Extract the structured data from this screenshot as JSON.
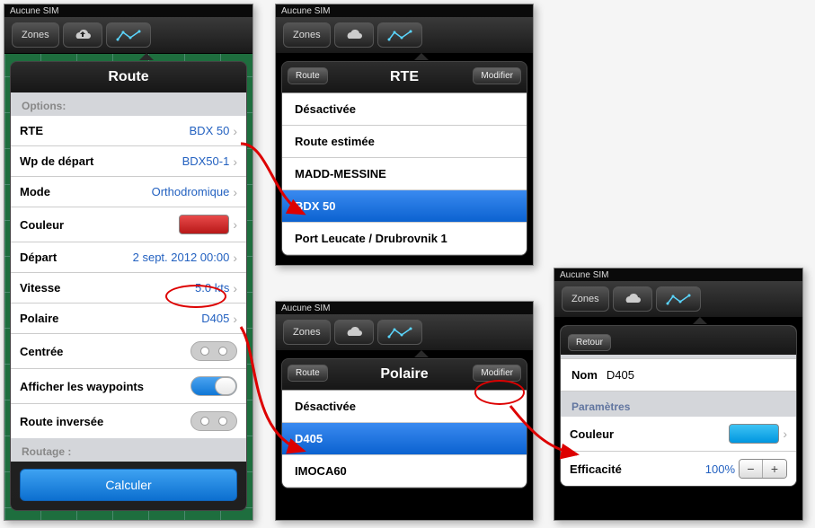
{
  "status": {
    "no_sim": "Aucune SIM"
  },
  "toolbar": {
    "zones_label": "Zones"
  },
  "panel_route": {
    "title": "Route",
    "section_options": "Options:",
    "rows": {
      "rte_label": "RTE",
      "rte_value": "BDX 50",
      "wp_label": "Wp de départ",
      "wp_value": "BDX50-1",
      "mode_label": "Mode",
      "mode_value": "Orthodromique",
      "color_label": "Couleur",
      "depart_label": "Départ",
      "depart_value": "2 sept. 2012 00:00",
      "speed_label": "Vitesse",
      "speed_value": "5.0 kts",
      "polar_label": "Polaire",
      "polar_value": "D405",
      "centered_label": "Centrée",
      "show_wp_label": "Afficher les waypoints",
      "reverse_label": "Route inversée"
    },
    "section_routing": "Routage :",
    "calc_button": "Calculer"
  },
  "panel_rte": {
    "title": "RTE",
    "back_label": "Route",
    "modify_label": "Modifier",
    "items": [
      "Désactivée",
      "Route estimée",
      "MADD-MESSINE",
      "BDX 50",
      "Port Leucate / Drubrovnik 1"
    ]
  },
  "panel_polaire": {
    "title": "Polaire",
    "back_label": "Route",
    "modify_label": "Modifier",
    "items": [
      "Désactivée",
      "D405",
      "IMOCA60"
    ]
  },
  "panel_edit": {
    "back_label": "Retour",
    "nom_label": "Nom",
    "nom_value": "D405",
    "params_label": "Paramètres",
    "color_label": "Couleur",
    "eff_label": "Efficacité",
    "eff_value": "100%"
  }
}
